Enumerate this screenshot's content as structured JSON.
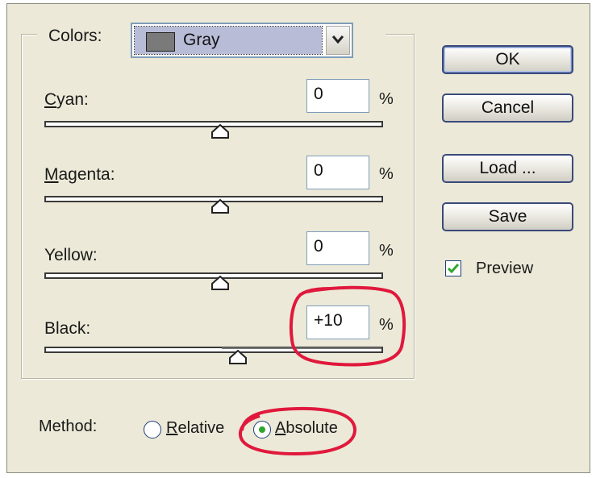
{
  "colors": {
    "label": "Colors:",
    "selected": "Gray",
    "swatch_color": "#7a7a7a"
  },
  "sliders": [
    {
      "label_first": "C",
      "label_rest": "yan:",
      "value": "0",
      "unit": "%",
      "position": 0.5
    },
    {
      "label_first": "M",
      "label_rest": "agenta:",
      "value": "0",
      "unit": "%",
      "position": 0.5
    },
    {
      "label_first": "",
      "label_rest": "Yellow:",
      "value": "0",
      "unit": "%",
      "position": 0.5
    },
    {
      "label_first": "",
      "label_rest": "Black:",
      "value": "+10",
      "unit": "%",
      "position": 0.55
    }
  ],
  "buttons": {
    "ok": "OK",
    "cancel": "Cancel",
    "load": "Load ...",
    "save": "Save"
  },
  "preview": {
    "label": "Preview",
    "checked": true
  },
  "method": {
    "label": "Method:",
    "relative_first": "R",
    "relative_rest": "elative",
    "absolute_first": "A",
    "absolute_rest": "bsolute",
    "selected": "Absolute"
  },
  "annotation_color": "#e0183c"
}
